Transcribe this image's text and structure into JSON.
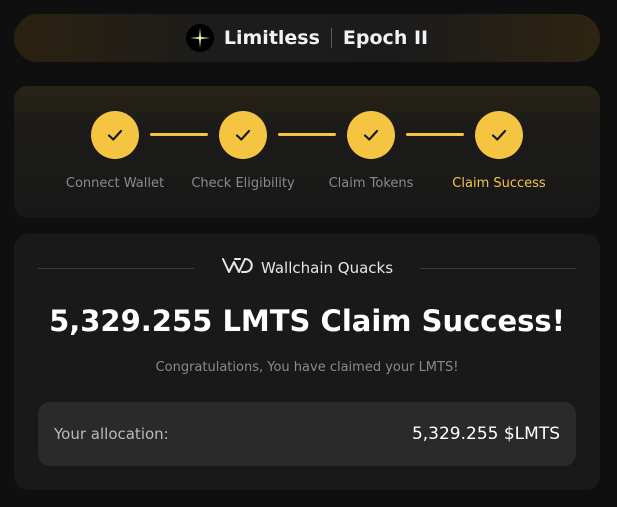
{
  "header": {
    "title": "Limitless",
    "epoch": "Epoch II",
    "logo_icon": "sparkle-star-icon"
  },
  "steps": [
    {
      "label": "Connect Wallet",
      "completed": true,
      "active": false
    },
    {
      "label": "Check Eligibility",
      "completed": true,
      "active": false
    },
    {
      "label": "Claim Tokens",
      "completed": true,
      "active": false
    },
    {
      "label": "Claim Success",
      "completed": true,
      "active": true
    }
  ],
  "claim": {
    "brand_name": "Wallchain Quacks",
    "brand_icon": "wallchain-logo-icon",
    "title": "5,329.255 LMTS Claim Success!",
    "subtitle": "Congratulations, You have claimed your LMTS!",
    "allocation_label": "Your allocation:",
    "allocation_value": "5,329.255 $LMTS"
  },
  "colors": {
    "accent": "#f5c542",
    "background": "#0f0f0f",
    "card": "#191919",
    "muted_text": "#8a8a8a"
  }
}
